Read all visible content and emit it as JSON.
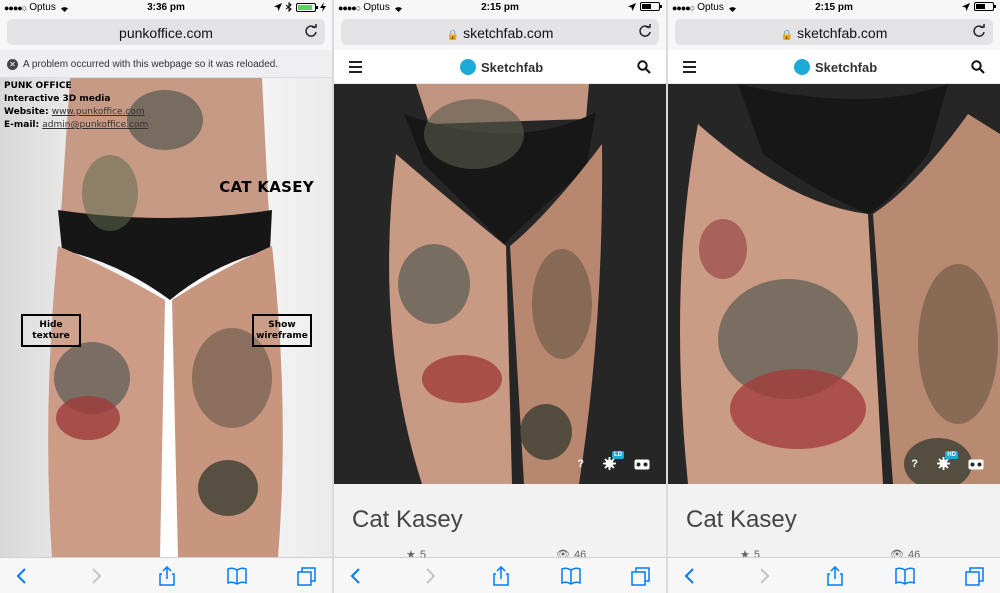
{
  "screens": [
    {
      "status": {
        "carrier": "Optus",
        "time": "3:36 pm"
      },
      "url": "punkoffice.com",
      "notice": "A problem occurred with this webpage so it was reloaded.",
      "info": {
        "line1": "PUNK OFFICE",
        "line2": "Interactive 3D media",
        "website_label": "Website:",
        "website": "www.punkoffice.com",
        "email_label": "E-mail:",
        "email": "admin@punkoffice.com"
      },
      "model_name": "CAT KASEY",
      "hide_texture": "Hide texture",
      "show_wireframe": "Show wireframe"
    },
    {
      "status": {
        "carrier": "Optus",
        "time": "2:15 pm"
      },
      "url": "sketchfab.com",
      "brand": "Sketchfab",
      "controls": {
        "help": "?",
        "quality_badge": "LD"
      },
      "title": "Cat Kasey",
      "likes": "5",
      "views": "46"
    },
    {
      "status": {
        "carrier": "Optus",
        "time": "2:15 pm"
      },
      "url": "sketchfab.com",
      "brand": "Sketchfab",
      "controls": {
        "help": "?",
        "quality_badge": "HD"
      },
      "title": "Cat Kasey",
      "likes": "5",
      "views": "46"
    }
  ],
  "colors": {
    "accent": "#1caad9",
    "ios_blue": "#007aff",
    "viewer_bg": "#262626"
  },
  "icons": [
    "back-icon",
    "forward-icon",
    "share-icon",
    "bookmarks-icon",
    "tabs-icon",
    "reload-icon",
    "lock-icon",
    "hamburger-icon",
    "search-icon",
    "gear-icon",
    "vr-icon",
    "star-icon",
    "eye-icon",
    "wifi-icon",
    "battery-icon",
    "location-icon",
    "bluetooth-icon",
    "close-circle-icon"
  ]
}
